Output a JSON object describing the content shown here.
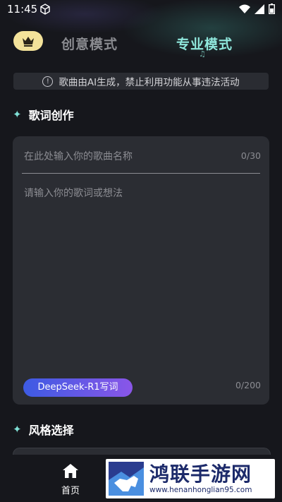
{
  "status_bar": {
    "time": "11:45"
  },
  "mode_tabs": {
    "creative": "创意模式",
    "pro": "专业模式"
  },
  "notice": {
    "text": "歌曲由AI生成，禁止利用功能从事违法活动"
  },
  "lyrics_section": {
    "title": "歌词创作",
    "song_name_placeholder": "在此处输入你的歌曲名称",
    "song_name_count": "0/30",
    "lyrics_placeholder": "请输入你的歌词或想法",
    "lyrics_count": "0/200",
    "ai_button": "DeepSeek-R1写词"
  },
  "style_section": {
    "title": "风格选择"
  },
  "bottom_nav": {
    "home_label": "首页"
  },
  "watermark": {
    "title": "鸿联手游网",
    "url": "www.henanhonglian95.com"
  },
  "colors": {
    "accent_teal": "#8fe7dc",
    "crown_bg": "#f3e29a",
    "button_start": "#3d5be3",
    "button_end": "#8a56e8"
  }
}
